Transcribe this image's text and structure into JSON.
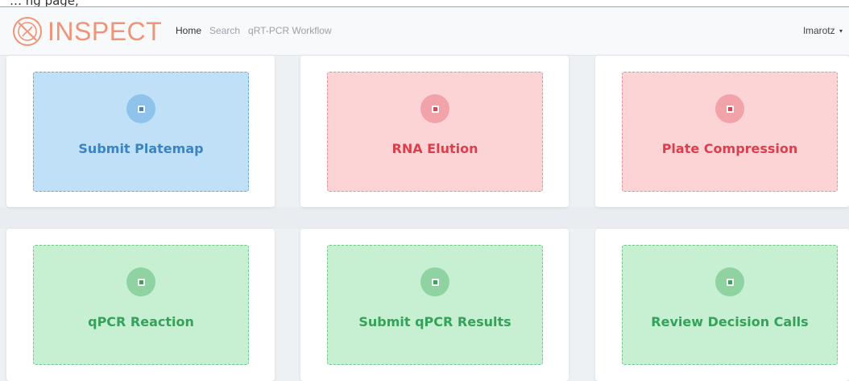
{
  "page_caption": "… ng page,",
  "brand": {
    "name": "INSPECT",
    "logo_icon": "inspect-logo-icon",
    "color": "#f09477"
  },
  "nav": {
    "items": [
      {
        "label": "Home",
        "active": true
      },
      {
        "label": "Search",
        "active": false
      },
      {
        "label": "qRT-PCR Workflow",
        "active": false
      }
    ]
  },
  "user": {
    "name": "lmarotz",
    "caret_icon": "caret-down-icon",
    "caret": "▾"
  },
  "colors": {
    "blue_tile": "#bfe0f7",
    "red_tile": "#fdd4d6",
    "green_tile": "#c6f0d1",
    "blue_text": "#3a84c3",
    "red_text": "#dc3f4b",
    "green_text": "#35a15b"
  },
  "workflow_tiles": [
    {
      "label": "Submit Platemap",
      "status": "blue",
      "icon": "plus-square-icon"
    },
    {
      "label": "RNA Elution",
      "status": "red",
      "icon": "plus-square-icon"
    },
    {
      "label": "Plate Compression",
      "status": "red",
      "icon": "plus-square-icon"
    },
    {
      "label": "qPCR Reaction",
      "status": "green",
      "icon": "plus-square-icon"
    },
    {
      "label": "Submit qPCR Results",
      "status": "green",
      "icon": "plus-square-icon"
    },
    {
      "label": "Review Decision Calls",
      "status": "green",
      "icon": "plus-square-icon"
    }
  ]
}
